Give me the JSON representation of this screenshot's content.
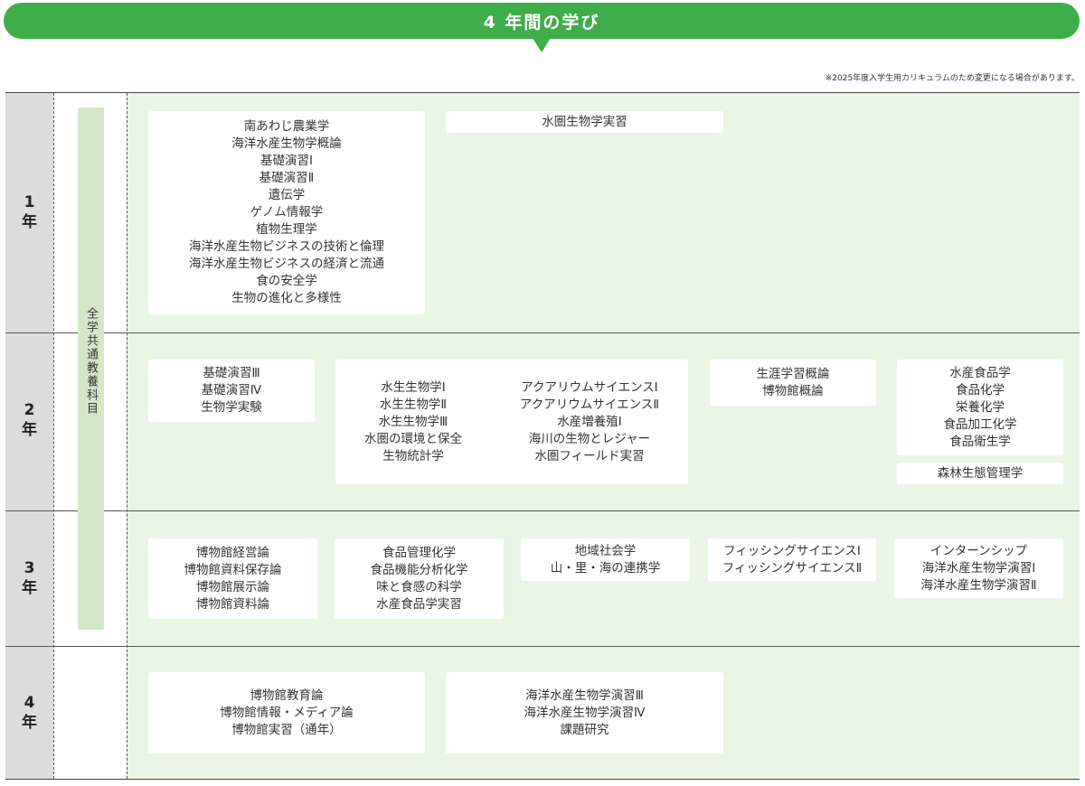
{
  "header": {
    "title": "4 年間の学び",
    "note": "※2025年度入学生用カリキュラムのため変更になる場合があります。"
  },
  "colors": {
    "accent_green": "#3fae49",
    "area_green": "#eaf4e4",
    "year_gray": "#dcdcdc"
  },
  "common": {
    "label": "全学共通教養科目"
  },
  "years": [
    {
      "label_num": "1",
      "label_unit": "年",
      "boxes": [
        {
          "items": [
            "南あわじ農業学",
            "海洋水産生物学概論",
            "基礎演習Ⅰ",
            "基礎演習Ⅱ",
            "遺伝学",
            "ゲノム情報学",
            "植物生理学",
            "海洋水産生物ビジネスの技術と倫理",
            "海洋水産生物ビジネスの経済と流通",
            "食の安全学",
            "生物の進化と多様性"
          ]
        },
        {
          "items": [
            "水圏生物学実習"
          ]
        }
      ]
    },
    {
      "label_num": "2",
      "label_unit": "年",
      "boxes": [
        {
          "items": [
            "基礎演習Ⅲ",
            "基礎演習Ⅳ",
            "生物学実験"
          ]
        },
        {
          "left": [
            "水生生物学Ⅰ",
            "水生生物学Ⅱ",
            "水生生物学Ⅲ",
            "水圏の環境と保全",
            "生物統計学"
          ],
          "right": [
            "アクアリウムサイエンスⅠ",
            "アクアリウムサイエンスⅡ",
            "水産増養殖Ⅰ",
            "海川の生物とレジャー",
            "水圏フィールド実習"
          ]
        },
        {
          "items": [
            "生涯学習概論",
            "博物館概論"
          ]
        },
        {
          "items": [
            "水産食品学",
            "食品化学",
            "栄養化学",
            "食品加工化学",
            "食品衛生学"
          ]
        },
        {
          "items": [
            "森林生態管理学"
          ]
        }
      ]
    },
    {
      "label_num": "3",
      "label_unit": "年",
      "boxes": [
        {
          "items": [
            "博物館経営論",
            "博物館資料保存論",
            "博物館展示論",
            "博物館資料論"
          ]
        },
        {
          "items": [
            "食品管理化学",
            "食品機能分析化学",
            "味と食感の科学",
            "水産食品学実習"
          ]
        },
        {
          "items": [
            "地域社会学",
            "山・里・海の連携学"
          ]
        },
        {
          "items": [
            "フィッシングサイエンスⅠ",
            "フィッシングサイエンスⅡ"
          ]
        },
        {
          "items": [
            "インターンシップ",
            "海洋水産生物学演習Ⅰ",
            "海洋水産生物学演習Ⅱ"
          ]
        }
      ]
    },
    {
      "label_num": "4",
      "label_unit": "年",
      "boxes": [
        {
          "items": [
            "博物館教育論",
            "博物館情報・メディア論",
            "博物館実習（通年）"
          ]
        },
        {
          "items": [
            "海洋水産生物学演習Ⅲ",
            "海洋水産生物学演習Ⅳ",
            "課題研究"
          ]
        }
      ]
    }
  ]
}
